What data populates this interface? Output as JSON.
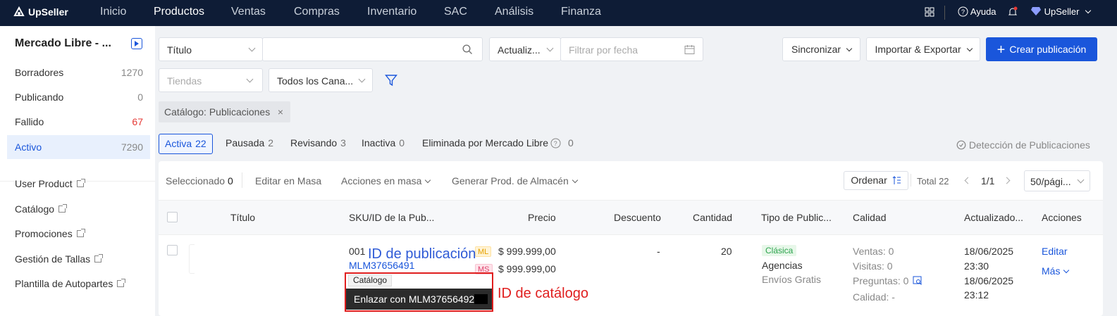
{
  "topbar": {
    "brand": "UpSeller",
    "nav": [
      "Inicio",
      "Productos",
      "Ventas",
      "Compras",
      "Inventario",
      "SAC",
      "Análisis",
      "Finanza"
    ],
    "active_nav": "Productos",
    "help": "Ayuda",
    "account": "UpSeller"
  },
  "sidebar": {
    "store": "Mercado Libre - ...",
    "items": [
      {
        "label": "Borradores",
        "count": "1270"
      },
      {
        "label": "Publicando",
        "count": "0"
      },
      {
        "label": "Fallido",
        "count": "67"
      },
      {
        "label": "Activo",
        "count": "7290"
      }
    ],
    "links": [
      "User Product",
      "Catálogo",
      "Promociones",
      "Gestión de Tallas",
      "Plantilla de Autopartes"
    ]
  },
  "filters": {
    "search_field": "Título",
    "date_type": "Actualiz...",
    "date_placeholder": "Filtrar por fecha",
    "stores_placeholder": "Tiendas",
    "channels": "Todos los Cana...",
    "active_tag": "Catálogo: Publicaciones"
  },
  "actions": {
    "sync": "Sincronizar",
    "import_export": "Importar & Exportar",
    "create": "Crear publicación"
  },
  "tabs": [
    {
      "label": "Activa",
      "count": "22"
    },
    {
      "label": "Pausada",
      "count": "2"
    },
    {
      "label": "Revisando",
      "count": "3"
    },
    {
      "label": "Inactiva",
      "count": "0"
    },
    {
      "label": "Eliminada por Mercado Libre",
      "count": "0"
    }
  ],
  "detection": "Detección de Publicaciones",
  "toolbar": {
    "selected_label": "Seleccionado",
    "selected_count": "0",
    "bulk_edit": "Editar en Masa",
    "bulk_actions": "Acciones en masa",
    "generate": "Generar Prod. de Almacén",
    "sort": "Ordenar",
    "total": "Total 22",
    "page": "1/1",
    "page_size": "50/pági..."
  },
  "columns": [
    "Título",
    "SKU/ID de la Pub...",
    "Precio",
    "Descuento",
    "Cantidad",
    "Tipo de Public...",
    "Calidad",
    "Actualizado...",
    "Acciones"
  ],
  "row": {
    "sku": "001",
    "pub_id": "MLM37656491",
    "badge_ml": "ML",
    "badge_ms": "MS",
    "price_ml": "$ 999.999,00",
    "price_ms": "$ 999.999,00",
    "discount": "-",
    "quantity": "20",
    "type": "Clásica",
    "shipping": "Agencias",
    "free_shipping": "Envíos Gratis",
    "sales": "Ventas: 0",
    "visits": "Visitas: 0",
    "questions": "Preguntas: 0",
    "quality": "Calidad: -",
    "updated_1": "18/06/2025",
    "updated_1_time": "23:30",
    "updated_2": "18/06/2025",
    "updated_2_time": "23:12",
    "edit": "Editar",
    "more": "Más"
  },
  "popup": {
    "label": "Catálogo",
    "link": "Enlazar con MLM37656492"
  },
  "annotations": {
    "pub_id": "ID de publicación",
    "catalog_id": "ID de catálogo"
  },
  "colors": {
    "topbar": "#0e1c36",
    "primary": "#1a56db",
    "annotation_red": "#e01e1e"
  }
}
